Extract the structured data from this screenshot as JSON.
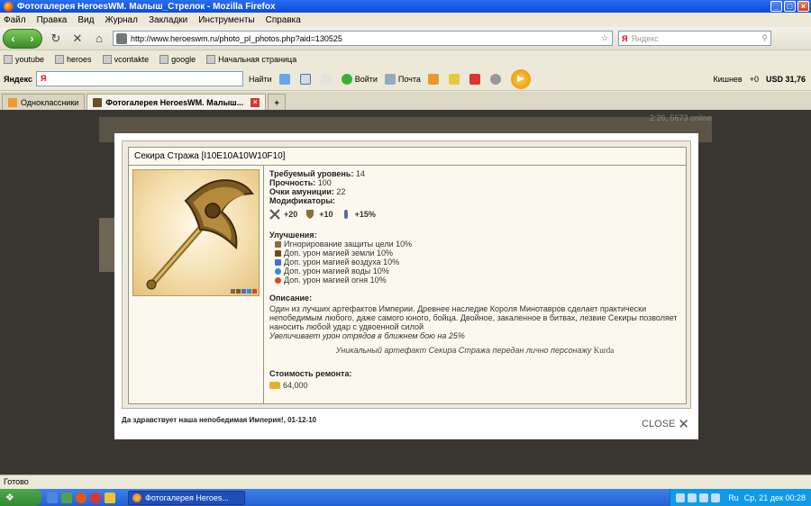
{
  "window": {
    "title": "Фотогалерея HeroesWM. Малыш_Стрелок - Mozilla Firefox"
  },
  "menu": [
    "Файл",
    "Правка",
    "Вид",
    "Журнал",
    "Закладки",
    "Инструменты",
    "Справка"
  ],
  "nav": {
    "url": "http://www.heroeswm.ru/photo_pl_photos.php?aid=130525",
    "search_placeholder": "Яндекс"
  },
  "bookmarks": [
    "youtube",
    "heroes",
    "vcontakte",
    "google",
    "Начальная страница"
  ],
  "yandex_bar": {
    "logo": "Яндекс",
    "find": "Найти",
    "login": "Войти",
    "mail": "Почта",
    "user": "Кишнев",
    "karma": "+0",
    "usd": "USD 31,76"
  },
  "tabs": [
    {
      "label": "Одноклассники",
      "active": false
    },
    {
      "label": "Фотогалерея HeroesWM. Малыш...",
      "active": true
    }
  ],
  "background": {
    "online": "2:26, 5673 online"
  },
  "item": {
    "title": "Секира Стража [I10E10A10W10F10]",
    "level_label": "Требуемый уровень:",
    "level": "14",
    "durability_label": "Прочность:",
    "durability": "100",
    "ammo_label": "Очки амуниции:",
    "ammo": "22",
    "modifiers_label": "Модификаторы:",
    "modifiers": [
      "+20",
      "+10",
      "+15%"
    ],
    "upgrades_label": "Улучшения:",
    "upgrades": [
      "Игнорирование защиты цели 10%",
      "Доп. урон магией земли 10%",
      "Доп. урон магией воздуха 10%",
      "Доп. урон магией воды 10%",
      "Доп. урон магией огня 10%"
    ],
    "description_label": "Описание:",
    "description": "Один из лучших артефактов Империи. Древнее наследие Короля Минотавров сделает практически непобедимым любого, даже самого юного, бойца. Двойное, закаленное в битвах, лезвие Секиры позволяет наносить любой удар с удвоенной силой",
    "description_bonus": "Увеличивает урон отрядов в ближнем бою на 25%",
    "unique_text": "Уникальный артефакт Секира Стража передан лично персонажу",
    "unique_owner": "Kurda",
    "repair_label": "Стоимость ремонта:",
    "repair_cost": "64,000"
  },
  "modal": {
    "footer": "Да здравствует наша непобедимая Империя!, 01-12-10",
    "close": "CLOSE"
  },
  "status": "Готово",
  "taskbar": {
    "task": "Фотогалерея Heroes...",
    "lang": "Ru",
    "clock": "Ср, 21 дек 00:28"
  }
}
